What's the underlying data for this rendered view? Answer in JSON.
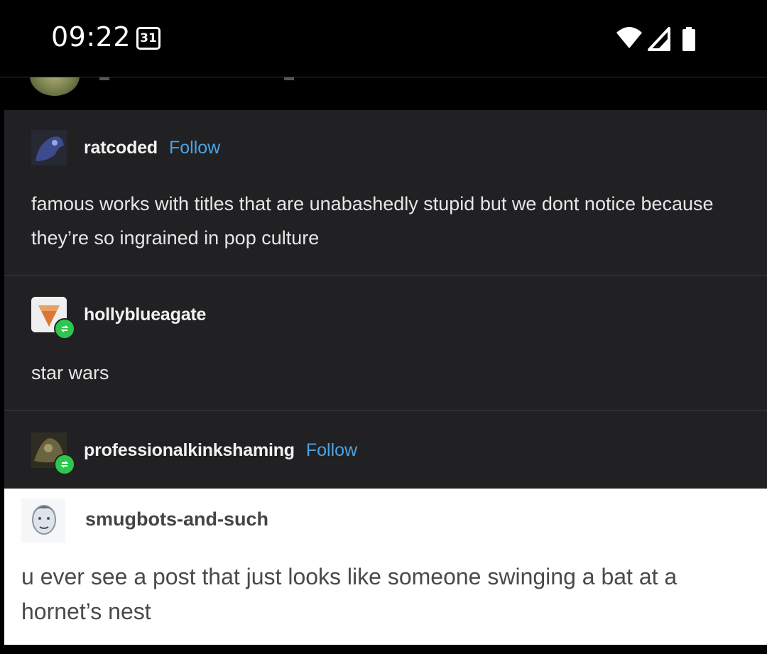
{
  "status_bar": {
    "time": "09:22",
    "calendar_day": "31",
    "icons": [
      "wifi-icon",
      "cell-signal-icon",
      "battery-icon"
    ]
  },
  "posts": [
    {
      "username": "ratcoded",
      "follow_label": "Follow",
      "text": "famous works with titles that are unabashedly stupid but we dont notice because they’re so ingrained in pop culture"
    },
    {
      "username": "hollyblueagate",
      "text": "star wars"
    },
    {
      "username": "professionalkinkshaming",
      "follow_label": "Follow"
    }
  ],
  "quoted_post": {
    "username": "smugbots-and-such",
    "text": "u ever see a post that just looks like someone swinging a bat at a hornet’s nest"
  },
  "colors": {
    "card_bg": "#212123",
    "follow_link": "#4aa3e6",
    "reblog_badge": "#2ec64e",
    "quoted_bg": "#ffffff"
  }
}
